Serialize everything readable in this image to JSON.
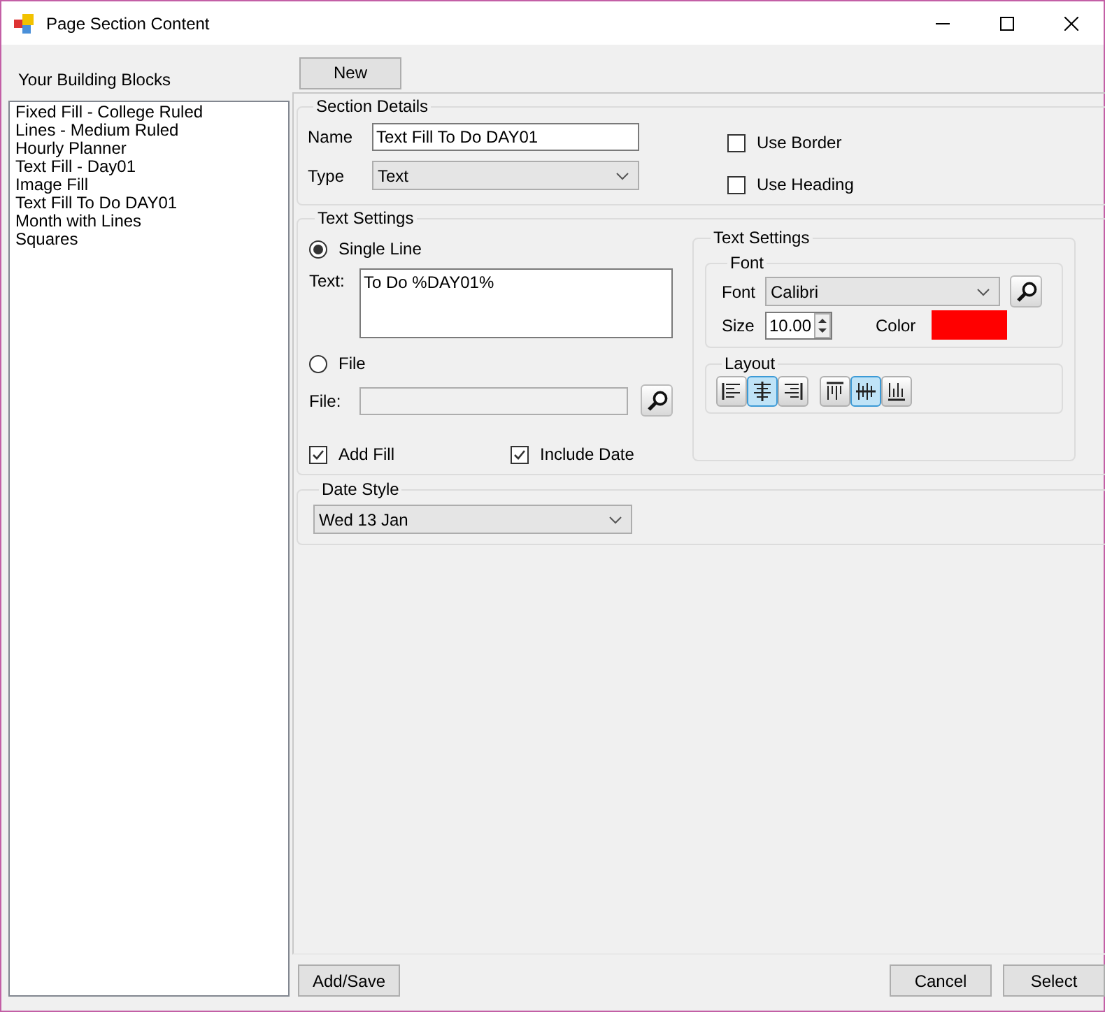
{
  "window": {
    "title": "Page Section Content"
  },
  "sidebar": {
    "heading": "Your Building Blocks",
    "items": [
      "Fixed Fill - College Ruled",
      "Lines - Medium Ruled",
      "Hourly Planner",
      "Text Fill - Day01",
      "Image Fill",
      "Text Fill To Do DAY01",
      "Month with Lines",
      "Squares"
    ]
  },
  "new_button": "New",
  "section_details": {
    "title": "Section Details",
    "name": {
      "label": "Name",
      "value": "Text Fill To Do DAY01"
    },
    "type": {
      "label": "Type",
      "value": "Text"
    },
    "use_border": {
      "label": "Use Border",
      "checked": false
    },
    "use_heading": {
      "label": "Use Heading",
      "checked": false
    }
  },
  "text_settings": {
    "title": "Text Settings",
    "single_line": {
      "label": "Single Line",
      "selected": true
    },
    "text": {
      "label": "Text:",
      "value": "To Do %DAY01%"
    },
    "file_option": {
      "label": "File",
      "selected": false
    },
    "file": {
      "label": "File:"
    },
    "add_fill": {
      "label": "Add Fill",
      "checked": true
    },
    "include_date": {
      "label": "Include Date",
      "checked": true
    },
    "inner": {
      "title": "Text Settings",
      "font_group": {
        "title": "Font",
        "font": {
          "label": "Font",
          "value": "Calibri"
        },
        "size": {
          "label": "Size",
          "value": "10.00"
        },
        "color": {
          "label": "Color",
          "color": "#ff0000"
        }
      },
      "layout": {
        "title": "Layout",
        "buttons": [
          {
            "kind": "align-left",
            "selected": false
          },
          {
            "kind": "align-center",
            "selected": true
          },
          {
            "kind": "align-right",
            "selected": false
          },
          {
            "kind": "valign-top",
            "selected": false
          },
          {
            "kind": "valign-middle",
            "selected": true
          },
          {
            "kind": "valign-bottom",
            "selected": false
          }
        ]
      }
    }
  },
  "date_style": {
    "title": "Date Style",
    "value": "Wed 13 Jan"
  },
  "buttons": {
    "add_save": "Add/Save",
    "cancel": "Cancel",
    "select": "Select"
  }
}
